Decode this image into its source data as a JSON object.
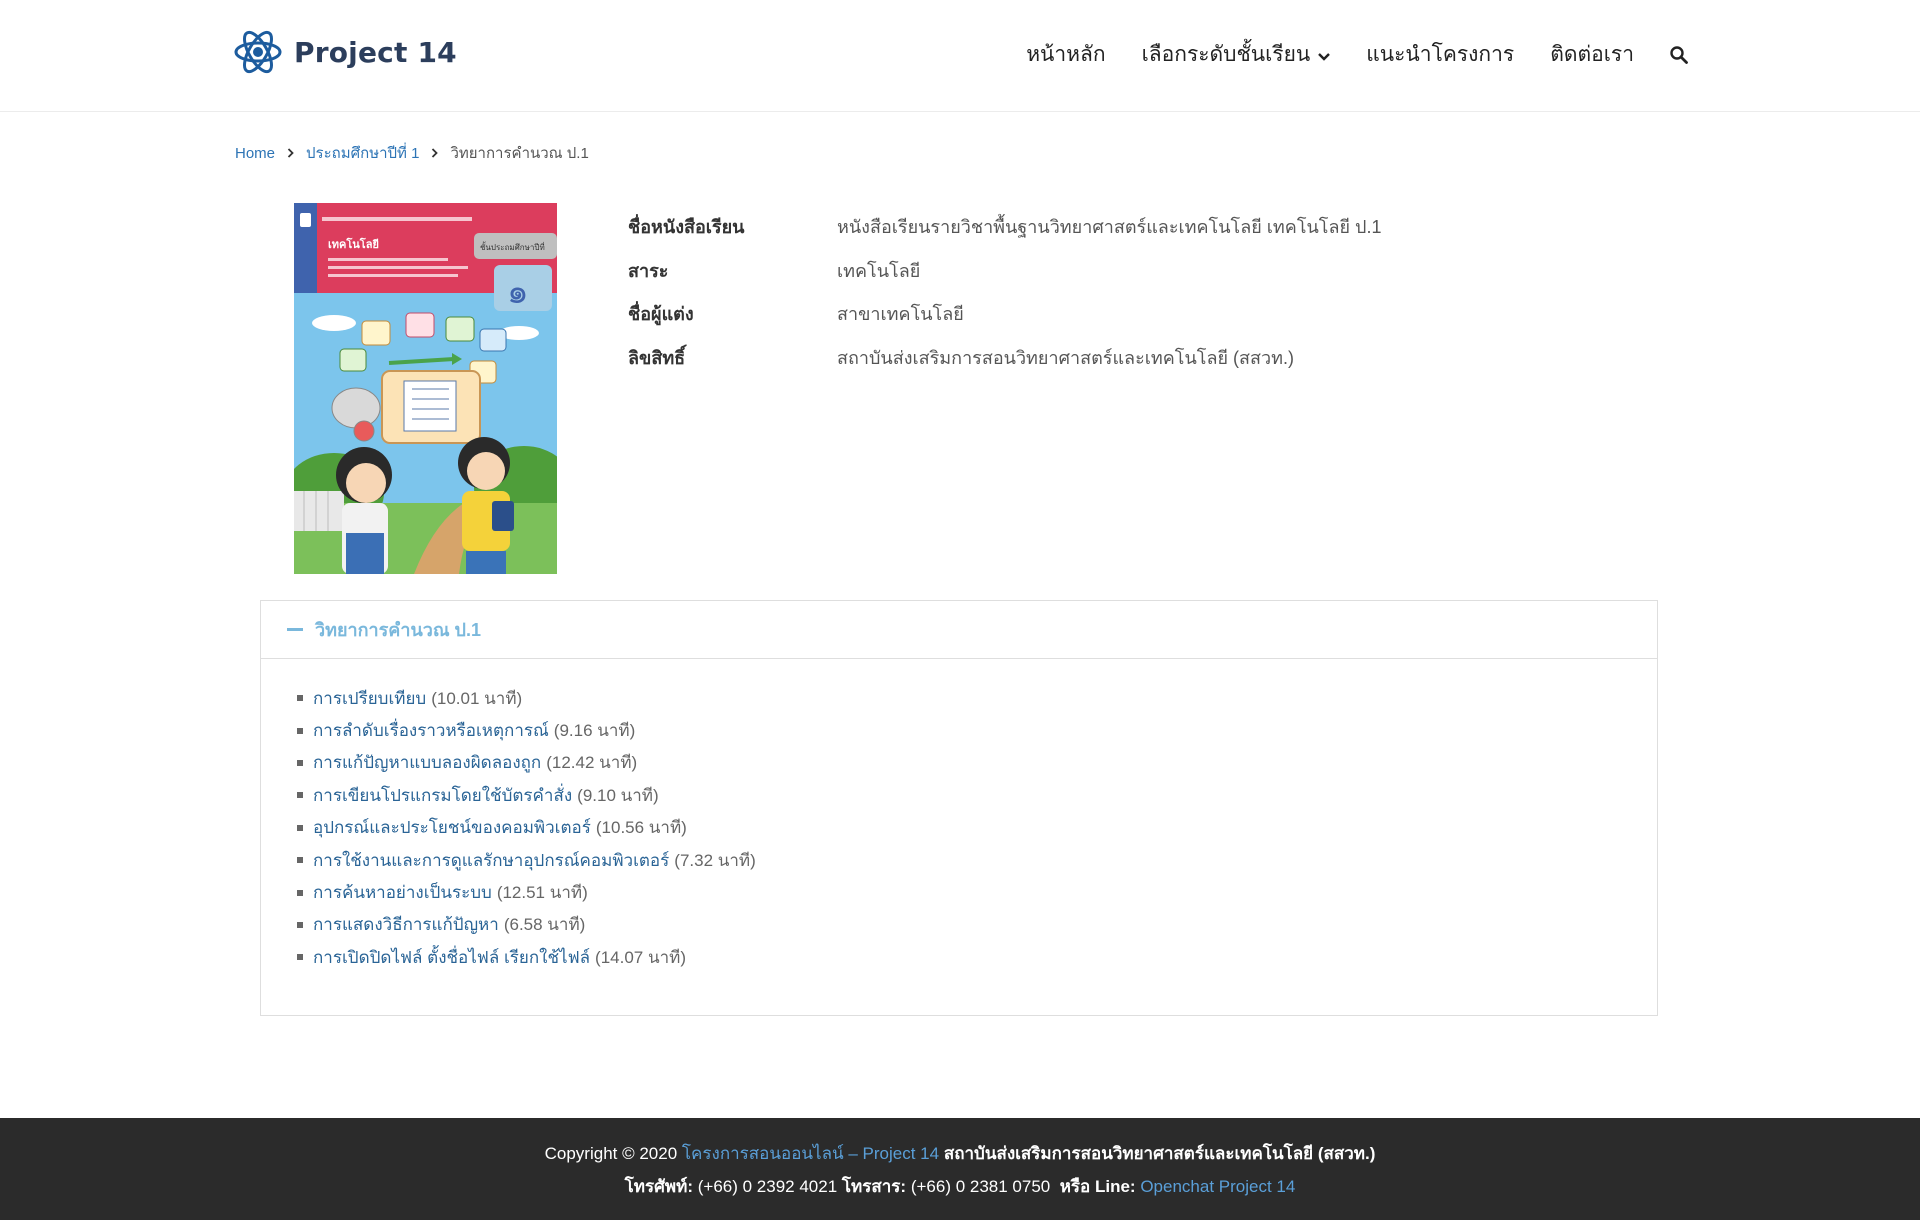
{
  "header": {
    "logo_text": "Project 14",
    "nav": {
      "home": "หน้าหลัก",
      "select_grade": "เลือกระดับชั้นเรียน",
      "about": "แนะนำโครงการ",
      "contact": "ติดต่อเรา"
    }
  },
  "breadcrumb": {
    "home": "Home",
    "level": "ประถมศึกษาปีที่ 1",
    "current": "วิทยาการคำนวณ ป.1"
  },
  "book": {
    "rows": [
      {
        "label": "ชื่อหนังสือเรียน",
        "value": "หนังสือเรียนรายวิชาพื้นฐานวิทยาศาสตร์และเทคโนโลยี เทคโนโลยี ป.1"
      },
      {
        "label": "สาระ",
        "value": "เทคโนโลยี"
      },
      {
        "label": "ชื่อผู้แต่ง",
        "value": "สาขาเทคโนโลยี"
      },
      {
        "label": "ลิขสิทธิ์",
        "value": "สถาบันส่งเสริมการสอนวิทยาศาสตร์และเทคโนโลยี (สสวท.)"
      }
    ]
  },
  "panel": {
    "title": "วิทยาการคำนวณ ป.1",
    "lessons": [
      {
        "title": "การเปรียบเทียบ",
        "duration": "(10.01 นาที)"
      },
      {
        "title": "การลำดับเรื่องราวหรือเหตุการณ์",
        "duration": "(9.16 นาที)"
      },
      {
        "title": "การแก้ปัญหาแบบลองผิดลองถูก",
        "duration": "(12.42 นาที)"
      },
      {
        "title": "การเขียนโปรแกรมโดยใช้บัตรคำสั่ง",
        "duration": "(9.10 นาที)"
      },
      {
        "title": "อุปกรณ์และประโยชน์ของคอมพิวเตอร์",
        "duration": "(10.56 นาที)"
      },
      {
        "title": "การใช้งานและการดูแลรักษาอุปกรณ์คอมพิวเตอร์",
        "duration": "(7.32 นาที)"
      },
      {
        "title": "การค้นหาอย่างเป็นระบบ",
        "duration": "(12.51 นาที)"
      },
      {
        "title": "การแสดงวิธีการแก้ปัญหา",
        "duration": "(6.58 นาที)"
      },
      {
        "title": "การเปิดปิดไฟล์ ตั้งชื่อไฟล์ เรียกใช้ไฟล์",
        "duration": "(14.07 นาที)"
      }
    ]
  },
  "footer": {
    "copyright_prefix": "Copyright © 2020",
    "site_link": "โครงการสอนออนไลน์ – Project 14",
    "org": "สถาบันส่งเสริมการสอนวิทยาศาสตร์และเทคโนโลยี (สสวท.)",
    "phone_label": "โทรศัพท์:",
    "phone": "(+66) 0 2392 4021",
    "fax_label": "โทรสาร:",
    "fax": "(+66) 0 2381 0750",
    "or_line_label": "หรือ Line:",
    "line_link": "Openchat Project 14"
  },
  "icons": {
    "logo": "atom-logo-icon",
    "dropdown": "chevron-down-icon",
    "search": "search-icon",
    "breadcrumb_separator": "chevron-right-icon",
    "panel_toggle": "minus-icon",
    "list_bullet": "square-bullet-icon"
  },
  "colors": {
    "link": "#2d74b5",
    "accent": "#7ab8dc",
    "footer_bg": "#2b2b2b",
    "footer_link": "#5a9fd8"
  },
  "cover_text": {
    "title": "เทคโนโลยี",
    "grade_tab": "ชั้นประถมศึกษาปีที่",
    "grade_number": "๑"
  }
}
